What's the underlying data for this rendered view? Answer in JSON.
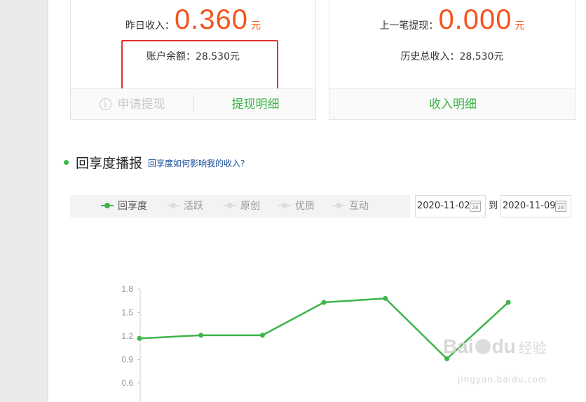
{
  "cards": {
    "yesterday": {
      "label": "昨日收入：",
      "value": "0.360",
      "unit": "元",
      "balance_text": "账户余额：28.530元",
      "apply_button": "申请提现",
      "detail_button": "提现明细"
    },
    "last_withdraw": {
      "label": "上一笔提现：",
      "value": "0.000",
      "unit": "元",
      "total_text": "历史总收入：28.530元",
      "detail_button": "收入明细"
    }
  },
  "section": {
    "title": "回享度播报",
    "help_link": "回享度如何影响我的收入?"
  },
  "filters": {
    "legend": [
      {
        "label": "回享度",
        "active": true
      },
      {
        "label": "活跃",
        "active": false
      },
      {
        "label": "原创",
        "active": false
      },
      {
        "label": "优质",
        "active": false
      },
      {
        "label": "互动",
        "active": false
      }
    ],
    "start_date": "2020-11-02",
    "to_label": "到",
    "end_date": "2020-11-09"
  },
  "chart_data": {
    "type": "line",
    "y_ticks": [
      "1.8",
      "1.5",
      "1.2",
      "0.9",
      "0.6"
    ],
    "ylim": [
      0.6,
      1.8
    ],
    "series": [
      {
        "values": [
          1.17,
          1.21,
          1.21,
          1.63,
          1.68,
          0.91,
          1.63
        ]
      }
    ],
    "color": "#3db54a"
  },
  "watermark": {
    "brand_a": "Bai",
    "brand_b": "du",
    "brand_cn": "经验",
    "url": "jingyan.baidu.com"
  }
}
